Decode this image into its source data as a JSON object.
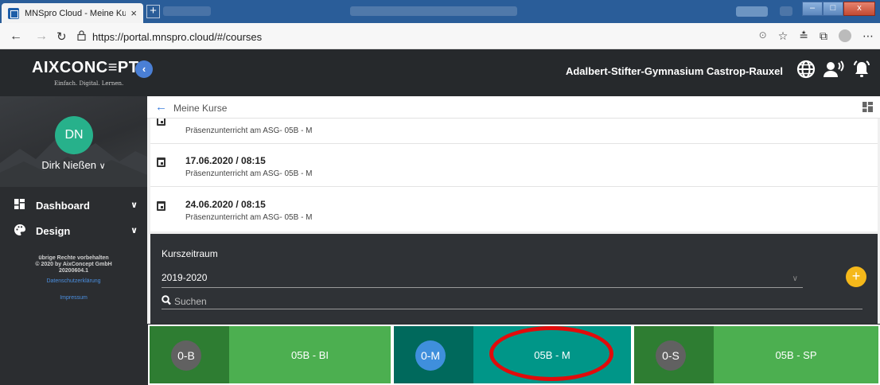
{
  "browser": {
    "tab_title": "MNSpro Cloud - Meine Kurse",
    "tab_close": "×",
    "new_tab": "+",
    "url": "https://portal.mnspro.cloud/#/courses"
  },
  "header": {
    "logo": "AIXCONC≡PT",
    "tagline": "Einfach. Digital. Lernen.",
    "school": "Adalbert-Stifter-Gymnasium Castrop-Rauxel",
    "icons": [
      "globe-icon",
      "user-voice-icon",
      "alarm-bell-icon"
    ]
  },
  "sidebar": {
    "avatar_initials": "DN",
    "user_name": "Dirk Nießen",
    "items": [
      {
        "label": "Dashboard",
        "icon": "dashboard-icon"
      },
      {
        "label": "Design",
        "icon": "palette-icon"
      }
    ],
    "footer": {
      "line1": "übrige Rechte vorbehalten",
      "line2": "© 2020 by AixConcept GmbH",
      "version": "20200604.1",
      "privacy_link": "Datenschutzerklärung",
      "imprint_link": "Impressum"
    }
  },
  "breadcrumb": {
    "label": "Meine Kurse"
  },
  "sessions": [
    {
      "date": "",
      "description": "Präsenzunterricht am ASG- 05B - M"
    },
    {
      "date": "17.06.2020 / 08:15",
      "description": "Präsenzunterricht am ASG- 05B - M"
    },
    {
      "date": "24.06.2020 / 08:15",
      "description": "Präsenzunterricht am ASG- 05B - M"
    }
  ],
  "filter": {
    "period_label": "Kurszeitraum",
    "period_value": "2019-2020",
    "search_placeholder": "Suchen",
    "add_label": "+"
  },
  "courses": [
    {
      "badge": "0-B",
      "name": "05B - BI",
      "left_color": "#2e7d32",
      "right_color": "#4caf50",
      "badge_color": "#616161"
    },
    {
      "badge": "0-M",
      "name": "05B - M",
      "left_color": "#00695c",
      "right_color": "#009688",
      "badge_color": "#3f8fdc"
    },
    {
      "badge": "0-S",
      "name": "05B - SP",
      "left_color": "#2e7d32",
      "right_color": "#4caf50",
      "badge_color": "#616161"
    }
  ],
  "colors": {
    "accent_blue": "#3b7ddd",
    "add_button": "#f5b81a",
    "avatar": "#27b18b",
    "highlight_ring": "#e10b0b"
  }
}
